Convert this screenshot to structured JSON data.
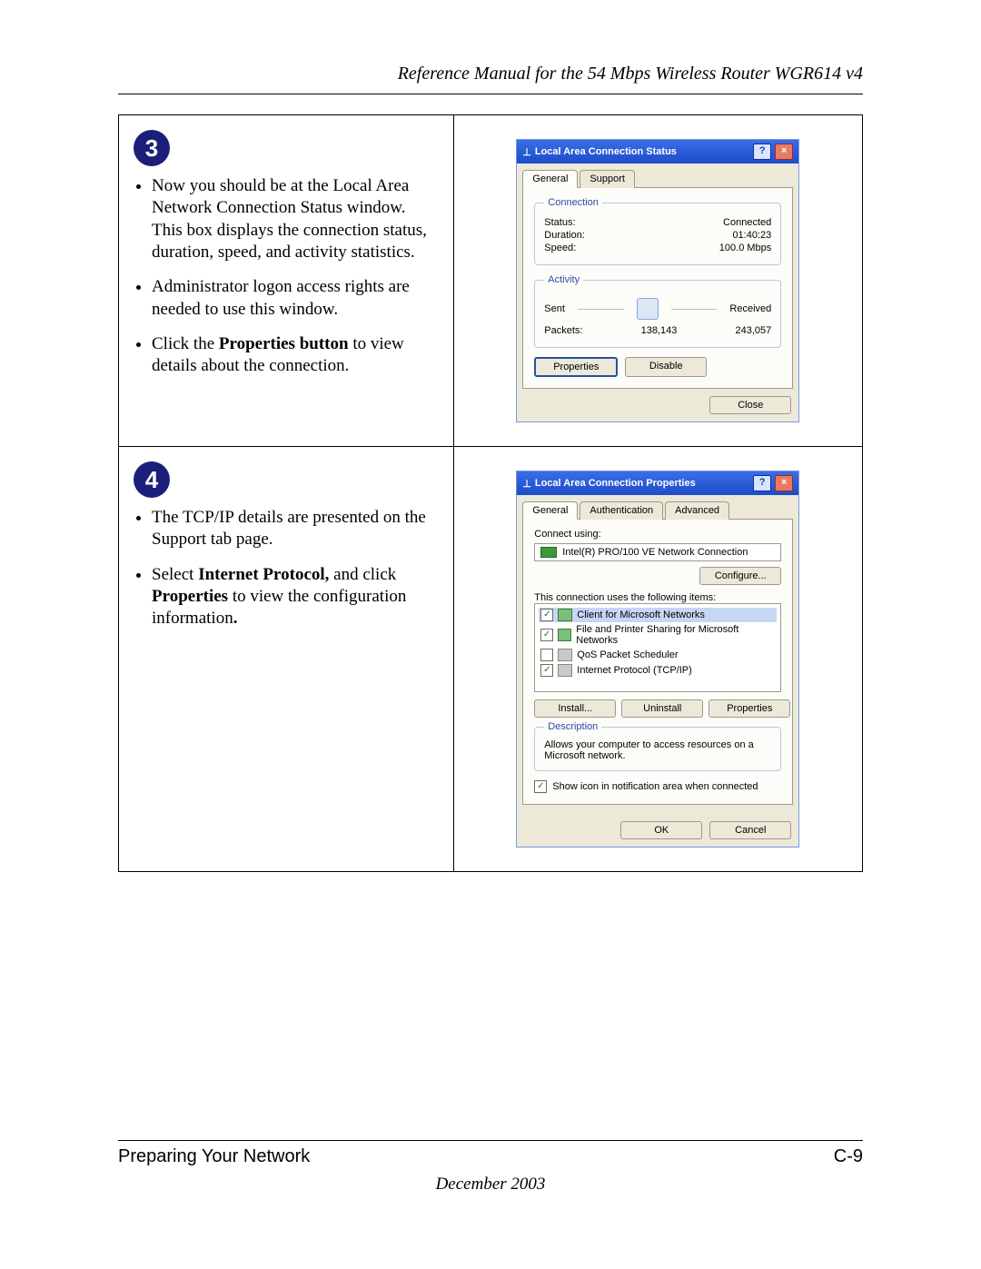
{
  "header": {
    "title": "Reference Manual for the 54 Mbps Wireless Router WGR614 v4"
  },
  "footer": {
    "left": "Preparing Your Network",
    "right": "C-9",
    "date": "December 2003"
  },
  "steps": {
    "s3": {
      "number": "3",
      "bullets": [
        "Now you should be at the Local Area Network Connection Status window. This box displays the connection status, duration, speed, and activity statistics.",
        "Administrator logon access rights are needed to use this window.",
        ""
      ],
      "b3_prefix": "Click the ",
      "b3_bold": "Properties button",
      "b3_suffix": " to view details about the connection."
    },
    "s4": {
      "number": "4",
      "b1": "The TCP/IP details are presented on the Support tab page.",
      "b2_prefix": "Select ",
      "b2_bold1": "Internet Protocol,",
      "b2_mid": " and click ",
      "b2_bold2": "Properties",
      "b2_suffix": " to view the configuration information",
      "b2_dot": "."
    }
  },
  "dlg_status": {
    "title": "Local Area Connection Status",
    "tabs": {
      "general": "General",
      "support": "Support"
    },
    "legend_conn": "Connection",
    "status_l": "Status:",
    "status_v": "Connected",
    "dur_l": "Duration:",
    "dur_v": "01:40:23",
    "speed_l": "Speed:",
    "speed_v": "100.0 Mbps",
    "legend_act": "Activity",
    "sent": "Sent",
    "received": "Received",
    "packets_l": "Packets:",
    "packets_sent": "138,143",
    "packets_recv": "243,057",
    "btn_properties": "Properties",
    "btn_disable": "Disable",
    "btn_close": "Close"
  },
  "dlg_props": {
    "title": "Local Area Connection Properties",
    "tabs": {
      "general": "General",
      "auth": "Authentication",
      "adv": "Advanced"
    },
    "connect_using_l": "Connect using:",
    "nic": "Intel(R) PRO/100 VE Network Connection",
    "btn_configure": "Configure...",
    "uses_l": "This connection uses the following items:",
    "items": [
      {
        "checked": true,
        "label": "Client for Microsoft Networks",
        "selected": true
      },
      {
        "checked": true,
        "label": "File and Printer Sharing for Microsoft Networks",
        "selected": false
      },
      {
        "checked": false,
        "label": "QoS Packet Scheduler",
        "selected": false
      },
      {
        "checked": true,
        "label": "Internet Protocol (TCP/IP)",
        "selected": false
      }
    ],
    "btn_install": "Install...",
    "btn_uninstall": "Uninstall",
    "btn_properties": "Properties",
    "legend_desc": "Description",
    "desc": "Allows your computer to access resources on a Microsoft network.",
    "show_icon": "Show icon in notification area when connected",
    "btn_ok": "OK",
    "btn_cancel": "Cancel"
  }
}
